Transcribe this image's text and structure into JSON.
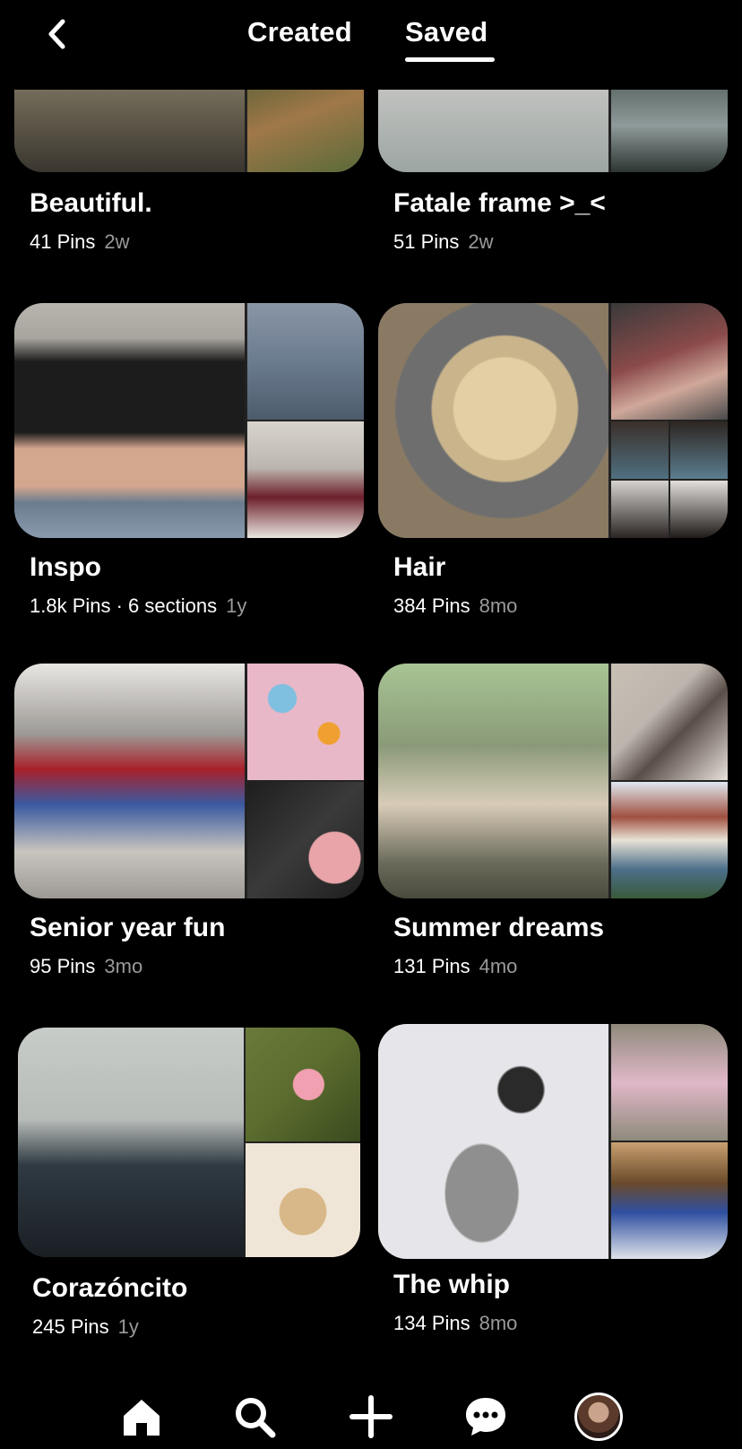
{
  "header": {
    "back_icon": "chevron-left-icon",
    "tabs": [
      {
        "label": "Created",
        "active": false
      },
      {
        "label": "Saved",
        "active": true
      }
    ]
  },
  "boards": [
    {
      "title": "Beautiful.",
      "pins": "41 Pins",
      "age": "2w",
      "cover_colors": [
        "#3e3b33",
        "#6a5a3e",
        "#b7c3c9"
      ]
    },
    {
      "title": "Fatale frame >_<",
      "pins": "51 Pins",
      "age": "2w",
      "cover_colors": [
        "#cfcdcb",
        "#3a4743",
        "#8f9b9a"
      ]
    },
    {
      "title": "Inspo",
      "pins": "1.8k Pins · 6 sections",
      "age": "1y",
      "cover_colors": [
        "#a8a49e",
        "#6b7c8f",
        "#6d1f2c"
      ]
    },
    {
      "title": "Hair",
      "pins": "384 Pins",
      "age": "8mo",
      "cover_colors": [
        "#c9b48c",
        "#8a4a4a",
        "#4f6f80"
      ]
    },
    {
      "title": "Senior year fun",
      "pins": "95 Pins",
      "age": "3mo",
      "cover_colors": [
        "#9d9a96",
        "#e9b8c8",
        "#1e1e1e"
      ]
    },
    {
      "title": "Summer dreams",
      "pins": "131 Pins",
      "age": "4mo",
      "cover_colors": [
        "#8a9a78",
        "#bdb6ae",
        "#4c6f8a"
      ]
    },
    {
      "title": "Corazóncito",
      "pins": "245 Pins",
      "age": "1y",
      "cover_colors": [
        "#2f3a43",
        "#5a6b2e",
        "#f0e6d8"
      ]
    },
    {
      "title": "The whip",
      "pins": "134 Pins",
      "age": "8mo",
      "cover_colors": [
        "#e6e6ea",
        "#8f8a7c",
        "#2f4fa0"
      ]
    }
  ],
  "nav": [
    {
      "icon": "home-icon",
      "active": true
    },
    {
      "icon": "search-icon",
      "active": false
    },
    {
      "icon": "plus-icon",
      "active": false
    },
    {
      "icon": "chat-bubble-icon",
      "active": false
    },
    {
      "icon": "profile-avatar",
      "active": false
    }
  ]
}
